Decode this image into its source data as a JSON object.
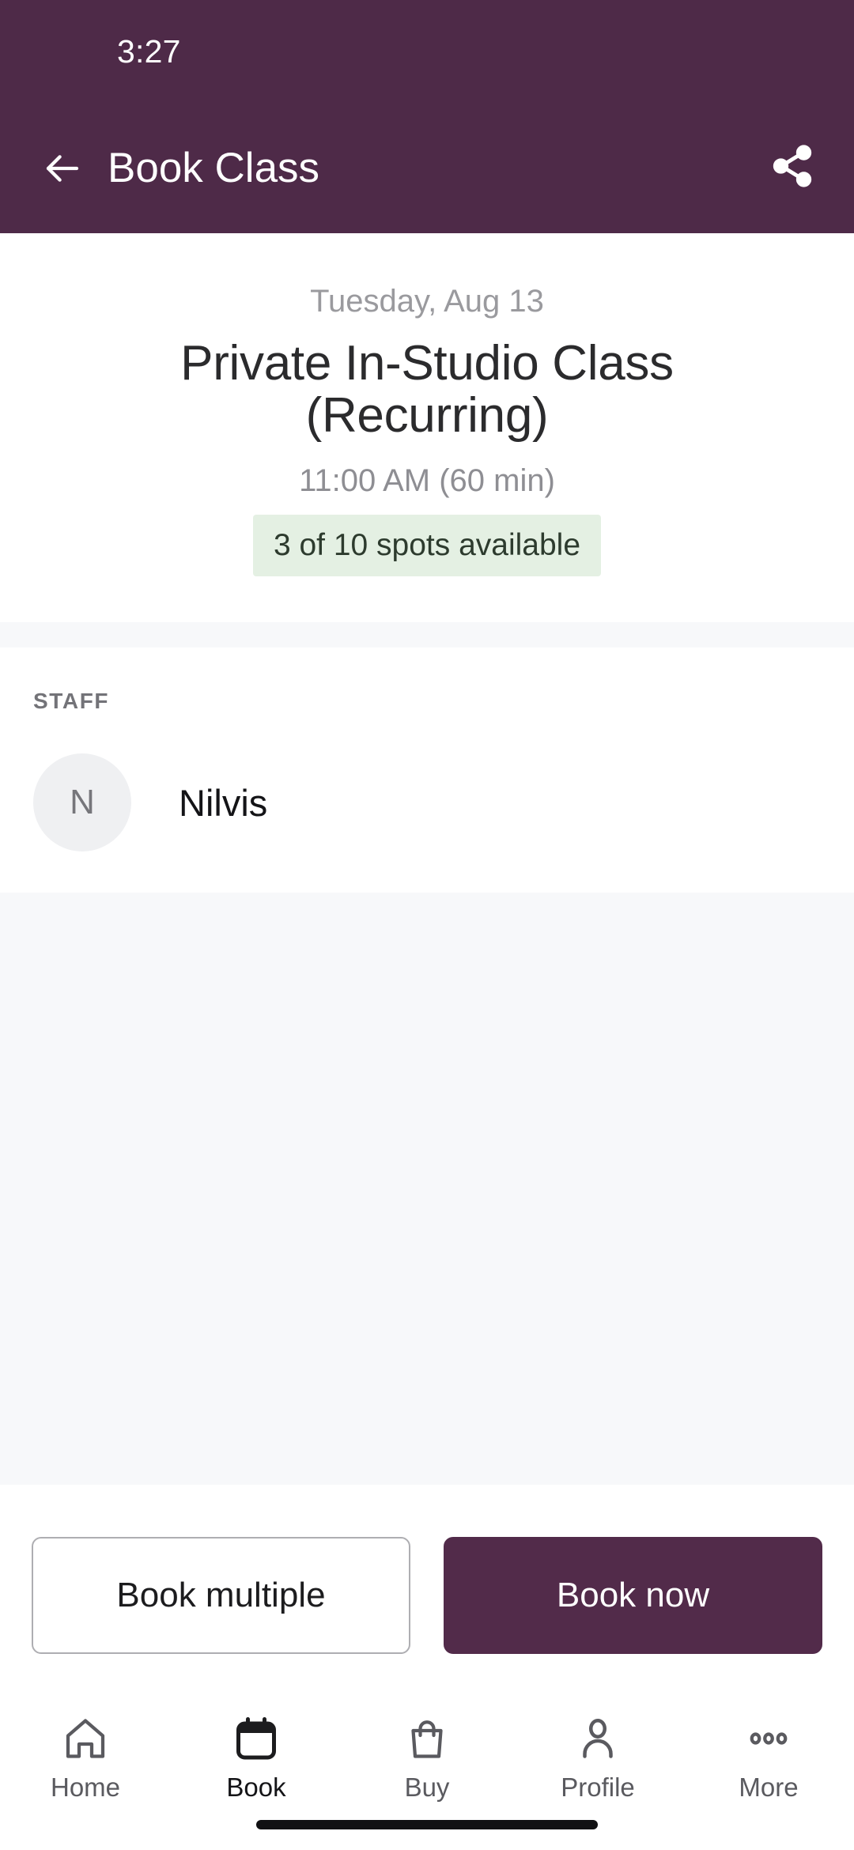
{
  "status_bar": {
    "time": "3:27"
  },
  "app_bar": {
    "title": "Book Class",
    "back_icon": "arrow-left-icon",
    "share_icon": "share-icon"
  },
  "hero": {
    "date": "Tuesday, Aug 13",
    "class_title": "Private In-Studio Class (Recurring)",
    "time_duration": "11:00 AM (60 min)",
    "availability": "3 of 10 spots available"
  },
  "staff": {
    "section_label": "STAFF",
    "members": [
      {
        "initial": "N",
        "name": "Nilvis"
      }
    ]
  },
  "actions": {
    "secondary_label": "Book multiple",
    "primary_label": "Book now"
  },
  "bottom_nav": {
    "items": [
      {
        "label": "Home",
        "icon": "home-icon",
        "active": false
      },
      {
        "label": "Book",
        "icon": "calendar-icon",
        "active": true
      },
      {
        "label": "Buy",
        "icon": "shopping-bag-icon",
        "active": false
      },
      {
        "label": "Profile",
        "icon": "person-icon",
        "active": false
      },
      {
        "label": "More",
        "icon": "ellipsis-icon",
        "active": false
      }
    ]
  },
  "colors": {
    "brand_purple": "#4E2A48",
    "primary_button": "#522B4A",
    "availability_badge_bg": "#E4F0E3",
    "page_bg_gray": "#F7F8FA",
    "avatar_bg": "#EFF0F2"
  }
}
